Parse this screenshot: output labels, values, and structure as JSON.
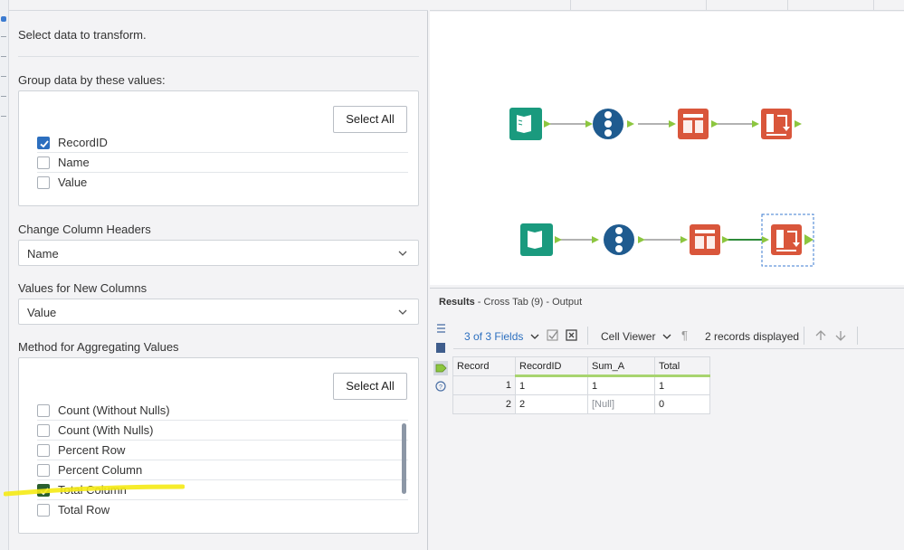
{
  "config": {
    "intro": "Select data to transform.",
    "group_by": {
      "label": "Group data by these values:",
      "select_all": "Select All",
      "options": [
        {
          "label": "RecordID",
          "checked": true
        },
        {
          "label": "Name",
          "checked": false
        },
        {
          "label": "Value",
          "checked": false
        }
      ]
    },
    "headers": {
      "label": "Change Column Headers",
      "value": "Name"
    },
    "values": {
      "label": "Values for New Columns",
      "value": "Value"
    },
    "method": {
      "label": "Method for Aggregating Values",
      "select_all": "Select All",
      "options": [
        {
          "label": "Count (Without Nulls)",
          "checked": false
        },
        {
          "label": "Count (With Nulls)",
          "checked": false
        },
        {
          "label": "Percent Row",
          "checked": false
        },
        {
          "label": "Percent Column",
          "checked": false
        },
        {
          "label": "Total Column",
          "checked": true
        },
        {
          "label": "Total Row",
          "checked": false
        }
      ]
    }
  },
  "results": {
    "title": "Results",
    "subtitle": " - Cross Tab (9) - Output",
    "fields": "3 of 3 Fields",
    "cell_viewer": "Cell Viewer",
    "records": "2 records displayed",
    "columns": [
      "Record",
      "RecordID",
      "Sum_A",
      "Total"
    ],
    "rows": [
      [
        "1",
        "1",
        "1",
        "1"
      ],
      [
        "2",
        "2",
        "[Null]",
        "0"
      ]
    ]
  },
  "colors": {
    "input_tool": "#1a9a7e",
    "recordid_tool": "#1f5b8f",
    "transform_tool": "#d9563b",
    "connector": "#8cc63f",
    "highlight": "#f5ea14"
  },
  "icons": [
    "book-input-icon",
    "record-id-icon",
    "cross-tab-icon",
    "transpose-icon",
    "chevron-down-icon",
    "list-icon",
    "table-icon",
    "tag-icon",
    "help-icon"
  ]
}
